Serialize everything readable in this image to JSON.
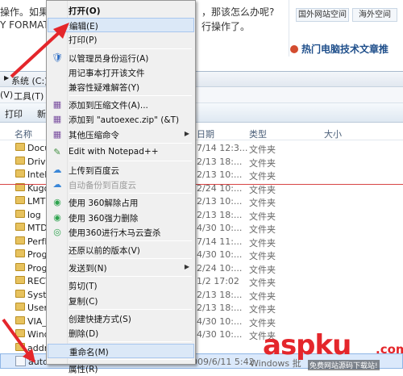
{
  "article": {
    "line1": "操作。如果在",
    "line1_right": "，那该怎么办呢?",
    "line2": "Y FORMAT",
    "line2_right": "行操作了。"
  },
  "right_panel": {
    "btn1": "国外网站空间",
    "btn2": "海外空间",
    "hot_title": "热门电脑技术文章推"
  },
  "explorer": {
    "address": "系统 (C:)",
    "menus": [
      "(V)",
      "工具(T)"
    ],
    "toolbar": [
      "打印",
      "新"
    ],
    "headers": {
      "name": "名称",
      "date": "日期",
      "type": "类型",
      "size": "大小"
    },
    "rows": [
      {
        "name": "Docu",
        "date": "7/14 12:3...",
        "type": "文件夹"
      },
      {
        "name": "Drive",
        "date": "2/13 18:...",
        "type": "文件夹"
      },
      {
        "name": "Intel",
        "date": "2/13 10:...",
        "type": "文件夹"
      },
      {
        "name": "Kugo",
        "date": "2/24 10:...",
        "type": "文件夹"
      },
      {
        "name": "LMTi",
        "date": "2/13 10:...",
        "type": "文件夹"
      },
      {
        "name": "log",
        "date": "2/13 18:...",
        "type": "文件夹"
      },
      {
        "name": "MTD",
        "date": "4/30 10:...",
        "type": "文件夹"
      },
      {
        "name": "PerfL",
        "date": "7/14 11:...",
        "type": "文件夹"
      },
      {
        "name": "Prog",
        "date": "4/30 10:...",
        "type": "文件夹"
      },
      {
        "name": "Prog",
        "date": "2/24 10:...",
        "type": "文件夹"
      },
      {
        "name": "RECY",
        "date": "1/2 17:02",
        "type": "文件夹"
      },
      {
        "name": "Syste",
        "date": "2/13 18:...",
        "type": "文件夹"
      },
      {
        "name": "Users",
        "date": "2/13 18:...",
        "type": "文件夹"
      },
      {
        "name": "VIA_1",
        "date": "4/30 10:...",
        "type": "文件夹"
      },
      {
        "name": "Wind",
        "date": "4/30 10:...",
        "type": "文件夹"
      },
      {
        "name": "addr",
        "date": "",
        "type": ""
      }
    ],
    "selected": {
      "name": "autoexec.bat",
      "date": "2009/6/11 5:42",
      "type": "Windows 批"
    }
  },
  "context_menu": {
    "items": [
      {
        "label": "打开(O)",
        "icon": "",
        "bold": true
      },
      {
        "label": "编辑(E)",
        "icon": "",
        "hover": true
      },
      {
        "label": "打印(P)",
        "icon": ""
      },
      {
        "label": "以管理员身份运行(A)",
        "icon": "shield"
      },
      {
        "label": "用记事本打开该文件",
        "icon": ""
      },
      {
        "label": "兼容性疑难解答(Y)",
        "icon": ""
      },
      {
        "label": "添加到压缩文件(A)...",
        "icon": "archive"
      },
      {
        "label": "添加到 \"autoexec.zip\" (&T)",
        "icon": "archive"
      },
      {
        "label": "其他压缩命令",
        "icon": "archive",
        "submenu": true
      },
      {
        "label": "Edit with Notepad++",
        "icon": "notepad"
      },
      {
        "label": "上传到百度云",
        "icon": "cloud"
      },
      {
        "label": "自动备份到百度云",
        "icon": "cloud",
        "disabled": true
      },
      {
        "label": "使用 360解除占用",
        "icon": "360"
      },
      {
        "label": "使用 360强力删除",
        "icon": "360"
      },
      {
        "label": "使用360进行木马云查杀",
        "icon": "360scan"
      },
      {
        "label": "还原以前的版本(V)",
        "icon": ""
      },
      {
        "label": "发送到(N)",
        "icon": "",
        "submenu": true
      },
      {
        "label": "剪切(T)",
        "icon": ""
      },
      {
        "label": "复制(C)",
        "icon": ""
      },
      {
        "label": "创建快捷方式(S)",
        "icon": ""
      },
      {
        "label": "删除(D)",
        "icon": ""
      },
      {
        "label": "重命名(M)",
        "icon": "",
        "hover": true
      },
      {
        "label": "属性(R)",
        "icon": ""
      }
    ]
  },
  "watermark": {
    "main": "aspku",
    "net": ".com",
    "sub": "免费网站源码下载站!"
  },
  "colors": {
    "accent_red": "#e4262b",
    "menu_hover": "#dbe8f7",
    "selection": "#dbe9fb"
  }
}
